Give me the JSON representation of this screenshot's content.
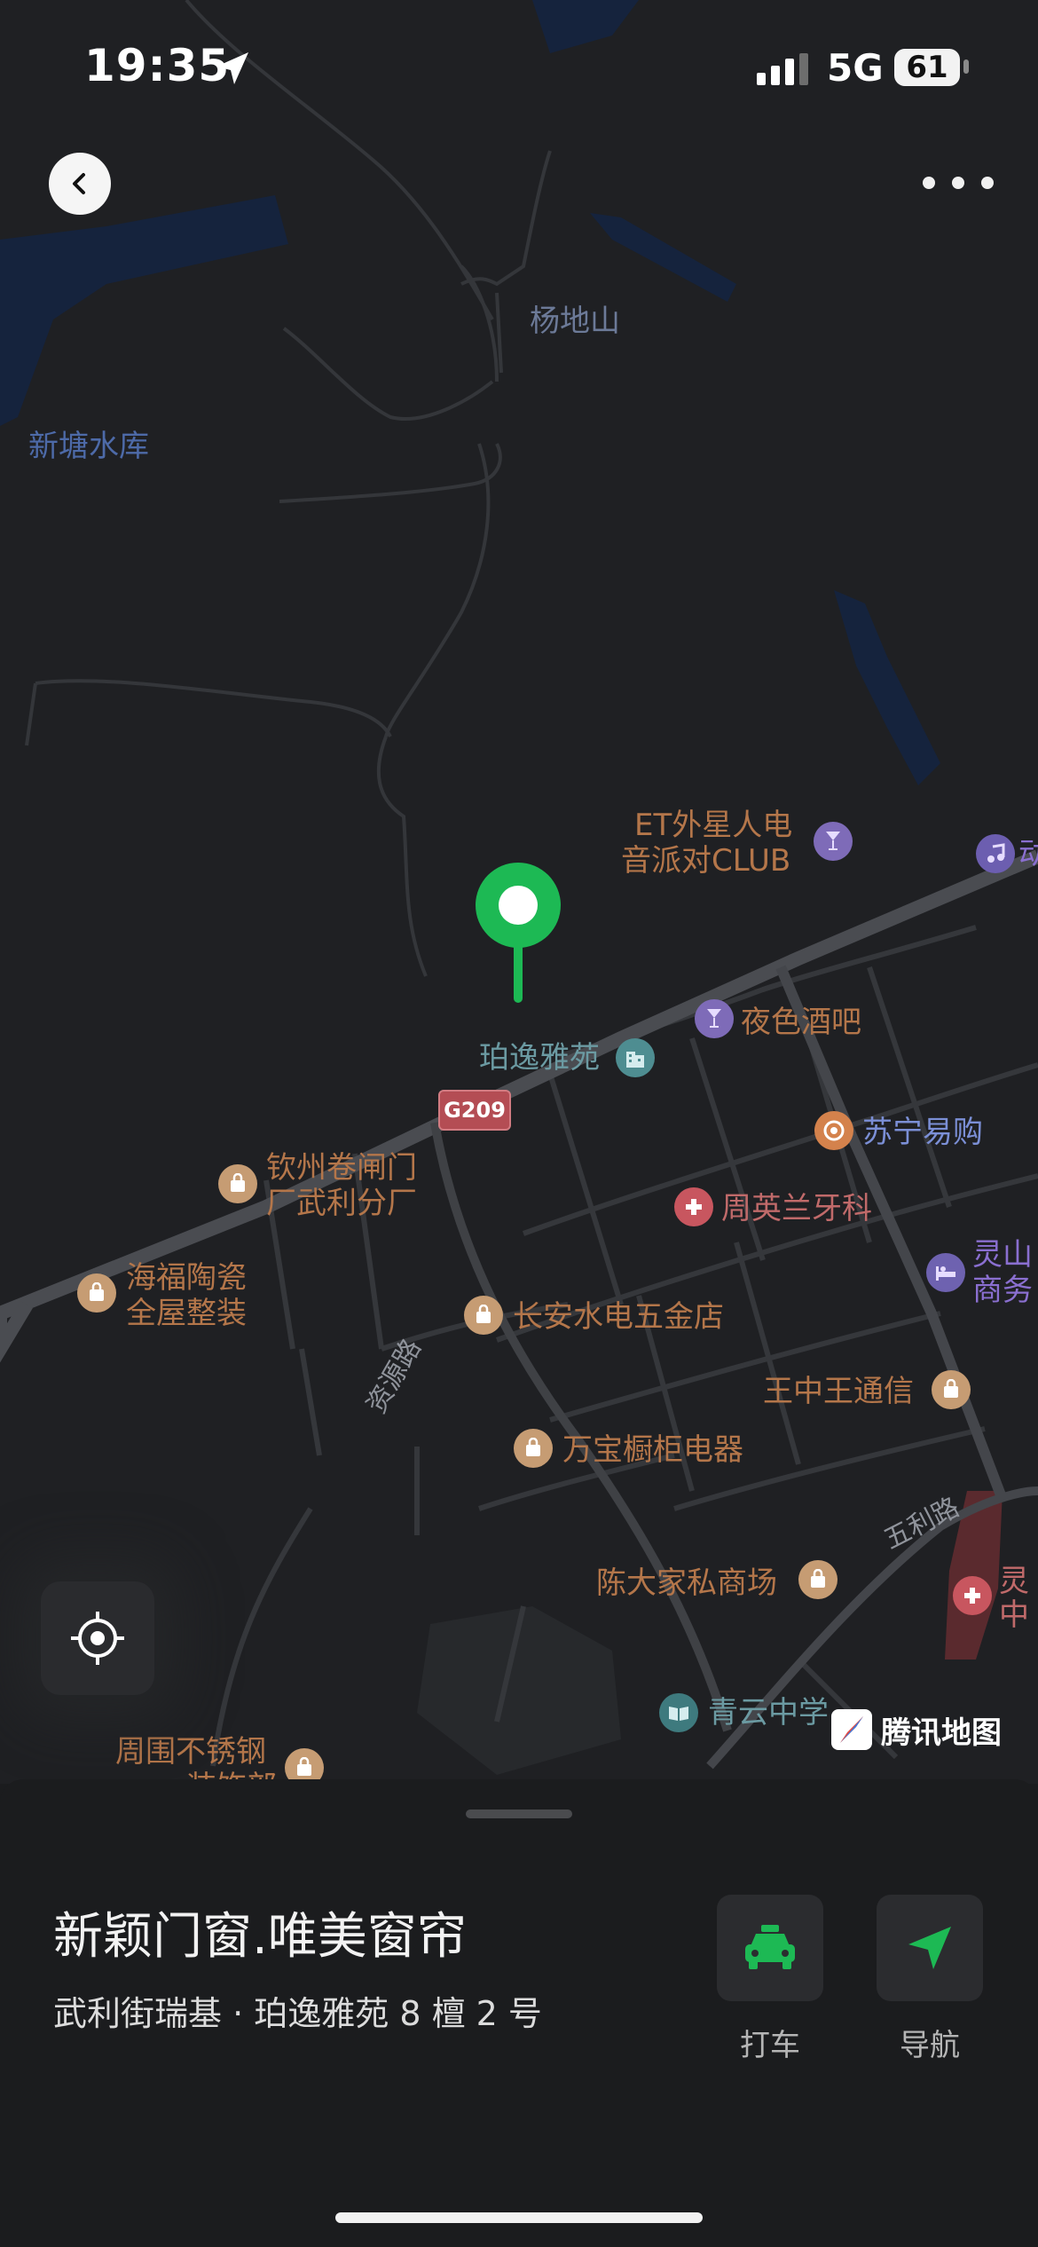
{
  "status_bar": {
    "time": "19:35",
    "network": "5G",
    "battery": "61"
  },
  "map": {
    "area_labels": [
      "杨地山"
    ],
    "water_labels": [
      "新塘水库"
    ],
    "road_labels": [
      "资源路",
      "五利路"
    ],
    "highway_shield": "G209",
    "selected_poi": "珀逸雅苑",
    "pois": [
      {
        "line1": "ET外星人电",
        "line2": "音派对CLUB"
      },
      {
        "line1": "夜色酒吧"
      },
      {
        "line1": "苏宁易购"
      },
      {
        "line1": "钦州卷闸门",
        "line2": "厂武利分厂"
      },
      {
        "line1": "周英兰牙科"
      },
      {
        "line1": "灵山",
        "line2": "商务"
      },
      {
        "line1": "海福陶瓷",
        "line2": "全屋整装"
      },
      {
        "line1": "长安水电五金店"
      },
      {
        "line1": "王中王通信"
      },
      {
        "line1": "万宝橱柜电器"
      },
      {
        "line1": "陈大家私商场"
      },
      {
        "line1": "灵",
        "line2": "中"
      },
      {
        "line1": "青云中学"
      },
      {
        "line1": "周围不锈钢",
        "line2": "装饰部"
      },
      {
        "line1": "动"
      }
    ],
    "brand": "腾讯地图"
  },
  "place": {
    "name": "新颖门窗.唯美窗帘",
    "address": "武利街瑞基 · 珀逸雅苑 8 檀 2 号"
  },
  "actions": {
    "taxi_label": "打车",
    "navigate_label": "导航"
  },
  "colors": {
    "accent_green": "#1db954",
    "map_bg": "#1f2023",
    "sheet_bg": "#1b1c1e"
  }
}
